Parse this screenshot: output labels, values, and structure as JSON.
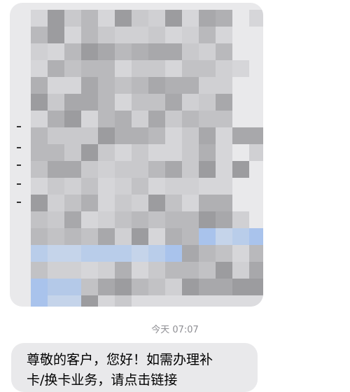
{
  "conversation": {
    "previous_message": {
      "redacted": true,
      "mosaic_palette": [
        "#c9c9cc",
        "#b9b9bc",
        "#a8a8ab",
        "#d6d6d9",
        "#9c9c9f",
        "#c2c2c5",
        "#b0b0b3",
        "#d0d0d3"
      ],
      "highlight_palette": [
        "#b9cdea",
        "#a9c3ec",
        "#c5d4ea",
        "#b4c9e8"
      ]
    },
    "timestamp": "今天 07:07",
    "latest_message": {
      "line1": "尊敬的客户，您好！如需办理补",
      "line2": "卡/换卡业务，请点击链接"
    }
  }
}
